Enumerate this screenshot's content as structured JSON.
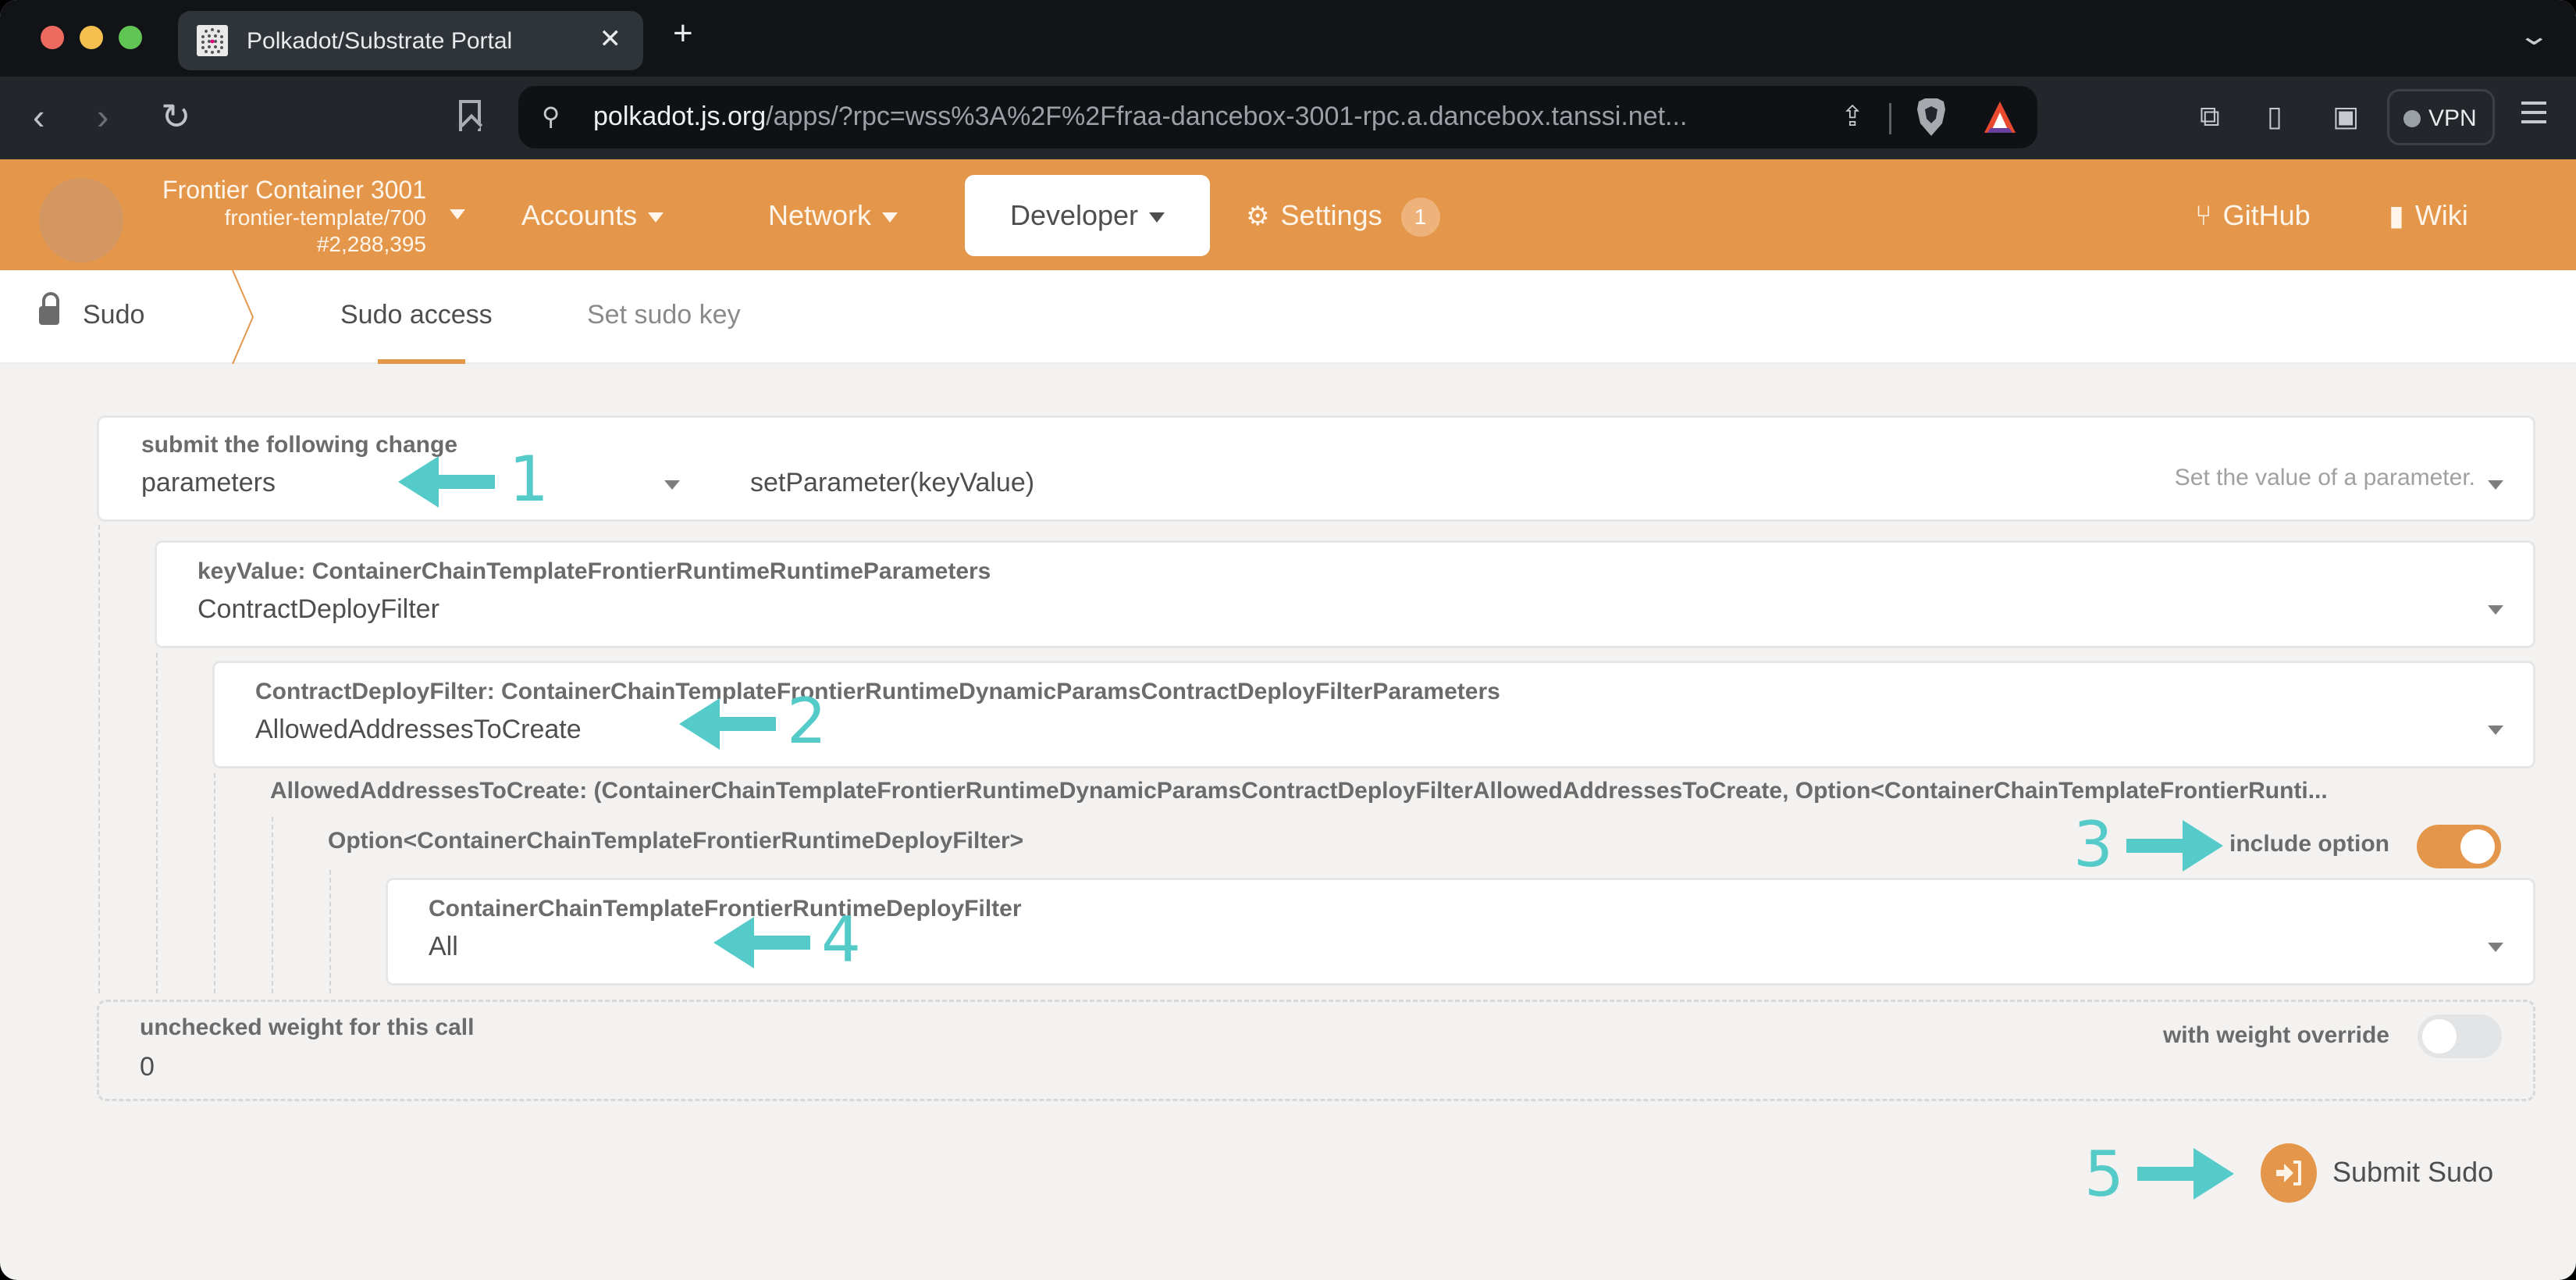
{
  "browser": {
    "tab_title": "Polkadot/Substrate Portal",
    "tab_close": "✕",
    "new_tab": "+",
    "url_host": "polkadot.js.org",
    "url_rest": "/apps/?rpc=wss%3A%2F%2Ffraa-dancebox-3001-rpc.a.dancebox.tanssi.net...",
    "vpn_label": "VPN"
  },
  "header": {
    "chain_name": "Frontier Container 3001",
    "runtime": "frontier-template/700",
    "block": "#2,288,395",
    "menu": {
      "accounts": "Accounts",
      "network": "Network",
      "developer": "Developer",
      "settings": "Settings",
      "settings_badge": "1",
      "github": "GitHub",
      "wiki": "Wiki"
    }
  },
  "subnav": {
    "section": "Sudo",
    "tabs": [
      {
        "label": "Sudo access",
        "active": true
      },
      {
        "label": "Set sudo key",
        "active": false
      }
    ]
  },
  "form": {
    "call": {
      "label": "submit the following change",
      "pallet": "parameters",
      "method": "setParameter(keyValue)",
      "description": "Set the value of a parameter."
    },
    "key_value": {
      "label": "keyValue: ContainerChainTemplateFrontierRuntimeRuntimeParameters",
      "value": "ContractDeployFilter"
    },
    "contract_deploy_filter": {
      "label": "ContractDeployFilter: ContainerChainTemplateFrontierRuntimeDynamicParamsContractDeployFilterParameters",
      "value": "AllowedAddressesToCreate"
    },
    "allowed_addresses": {
      "label": "AllowedAddressesToCreate: (ContainerChainTemplateFrontierRuntimeDynamicParamsContractDeployFilterAllowedAddressesToCreate, Option<ContainerChainTemplateFrontierRunti..."
    },
    "option": {
      "label": "Option<ContainerChainTemplateFrontierRuntimeDeployFilter>",
      "toggle_label": "include option",
      "toggle_on": true
    },
    "deploy_filter": {
      "label": "ContainerChainTemplateFrontierRuntimeDeployFilter",
      "value": "All"
    },
    "weight": {
      "label": "unchecked weight for this call",
      "value": "0",
      "toggle_label": "with weight override",
      "toggle_on": false
    },
    "submit_label": "Submit Sudo"
  },
  "annotations": [
    "1",
    "2",
    "3",
    "4",
    "5"
  ],
  "colors": {
    "brand": "#e4974b",
    "annotation": "#55cbc9",
    "background": "#f3f2f1"
  }
}
